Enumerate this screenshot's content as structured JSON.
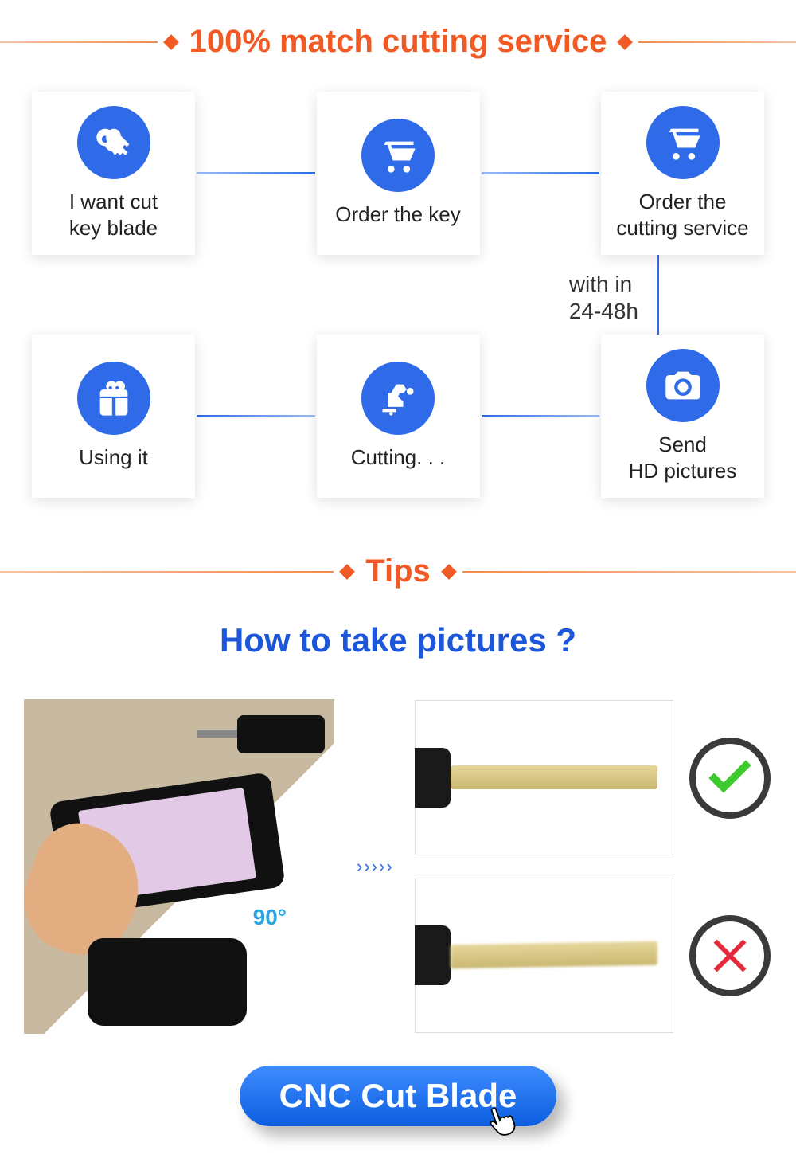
{
  "header1": "100% match cutting service",
  "steps_top": [
    {
      "label": "I want cut\nkey blade",
      "icon": "keys"
    },
    {
      "label": "Order the key",
      "icon": "cart"
    },
    {
      "label": "Order the\ncutting service",
      "icon": "cart"
    }
  ],
  "mid_note": "with in\n24-48h",
  "steps_bottom": [
    {
      "label": "Using it",
      "icon": "gift"
    },
    {
      "label": "Cutting. . .",
      "icon": "robot"
    },
    {
      "label": "Send\nHD pictures",
      "icon": "camera"
    }
  ],
  "header2": "Tips",
  "subtitle": "How to take pictures ?",
  "angle_label": "90°",
  "cta_label": "CNC Cut Blade"
}
